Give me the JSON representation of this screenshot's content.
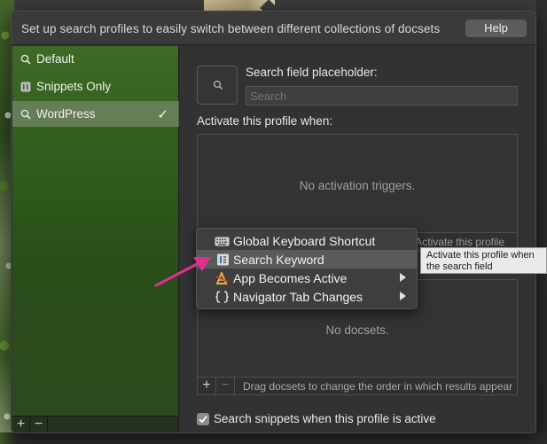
{
  "header": {
    "text": "Set up search profiles to easily switch between different collections of docsets",
    "help_label": "Help"
  },
  "sidebar": {
    "items": [
      {
        "label": "Default",
        "icon": "search-icon",
        "selected": false
      },
      {
        "label": "Snippets Only",
        "icon": "snippet-icon",
        "selected": false
      },
      {
        "label": "WordPress",
        "icon": "search-icon",
        "selected": true
      }
    ],
    "check_glyph": "✓",
    "add_label": "+",
    "remove_label": "−"
  },
  "main": {
    "placeholder_label": "Search field placeholder:",
    "search_placeholder": "Search",
    "activate_label": "Activate this profile when:",
    "triggers_empty": "No activation triggers.",
    "triggers_hint": "Activate this profile",
    "docsets_empty": "No docsets.",
    "docsets_add": "+",
    "docsets_remove": "−",
    "docsets_hint": "Drag docsets to change the order in which results appear",
    "snippets_checkbox_label": "Search snippets when this profile is active",
    "snippets_checked": true
  },
  "context_menu": {
    "items": [
      {
        "label": "Global Keyboard Shortcut",
        "icon": "keyboard-icon",
        "submenu": false,
        "highlighted": false
      },
      {
        "label": "Search Keyword",
        "icon": "keyword-icon",
        "submenu": false,
        "highlighted": true
      },
      {
        "label": "App Becomes Active",
        "icon": "app-icon",
        "submenu": true,
        "highlighted": false
      },
      {
        "label": "Navigator Tab Changes",
        "icon": "braces-icon",
        "submenu": true,
        "highlighted": false
      }
    ]
  },
  "tooltip": {
    "text": "Activate this profile when the search field"
  },
  "colors": {
    "accent_pink": "#e0308f",
    "sidebar_green": "#2f5a1c",
    "panel_bg": "#323232"
  }
}
